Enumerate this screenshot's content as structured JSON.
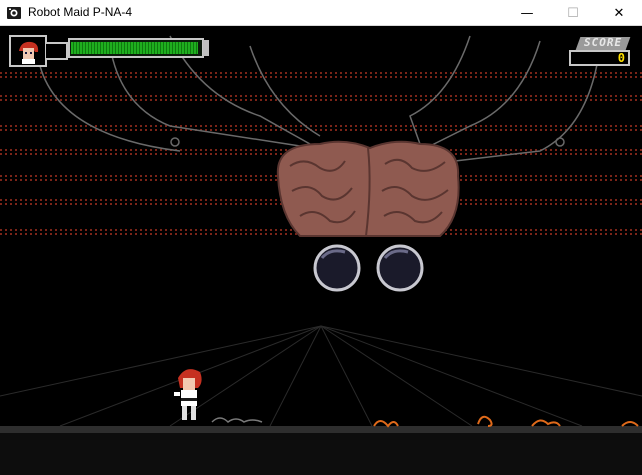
{
  "window": {
    "title": "Robot Maid P-NA-4",
    "minimize_glyph": "—",
    "maximize_glyph": "☐",
    "close_glyph": "✕",
    "icon": "game-app-icon"
  },
  "hud": {
    "score_label": "SCORE",
    "score_value": "0",
    "health_fraction": 0.98,
    "health_color": "#1fae1f",
    "portrait_icon": "robot-maid-portrait"
  },
  "scene": {
    "background_color": "#000000",
    "stripe_color": "#7a2418",
    "boss": "giant-brain-boss",
    "boss_color": "#8f5a50",
    "player": "robot-maid-player",
    "enemies": [
      "orange-crawler",
      "orange-crawler",
      "orange-crawler"
    ]
  }
}
